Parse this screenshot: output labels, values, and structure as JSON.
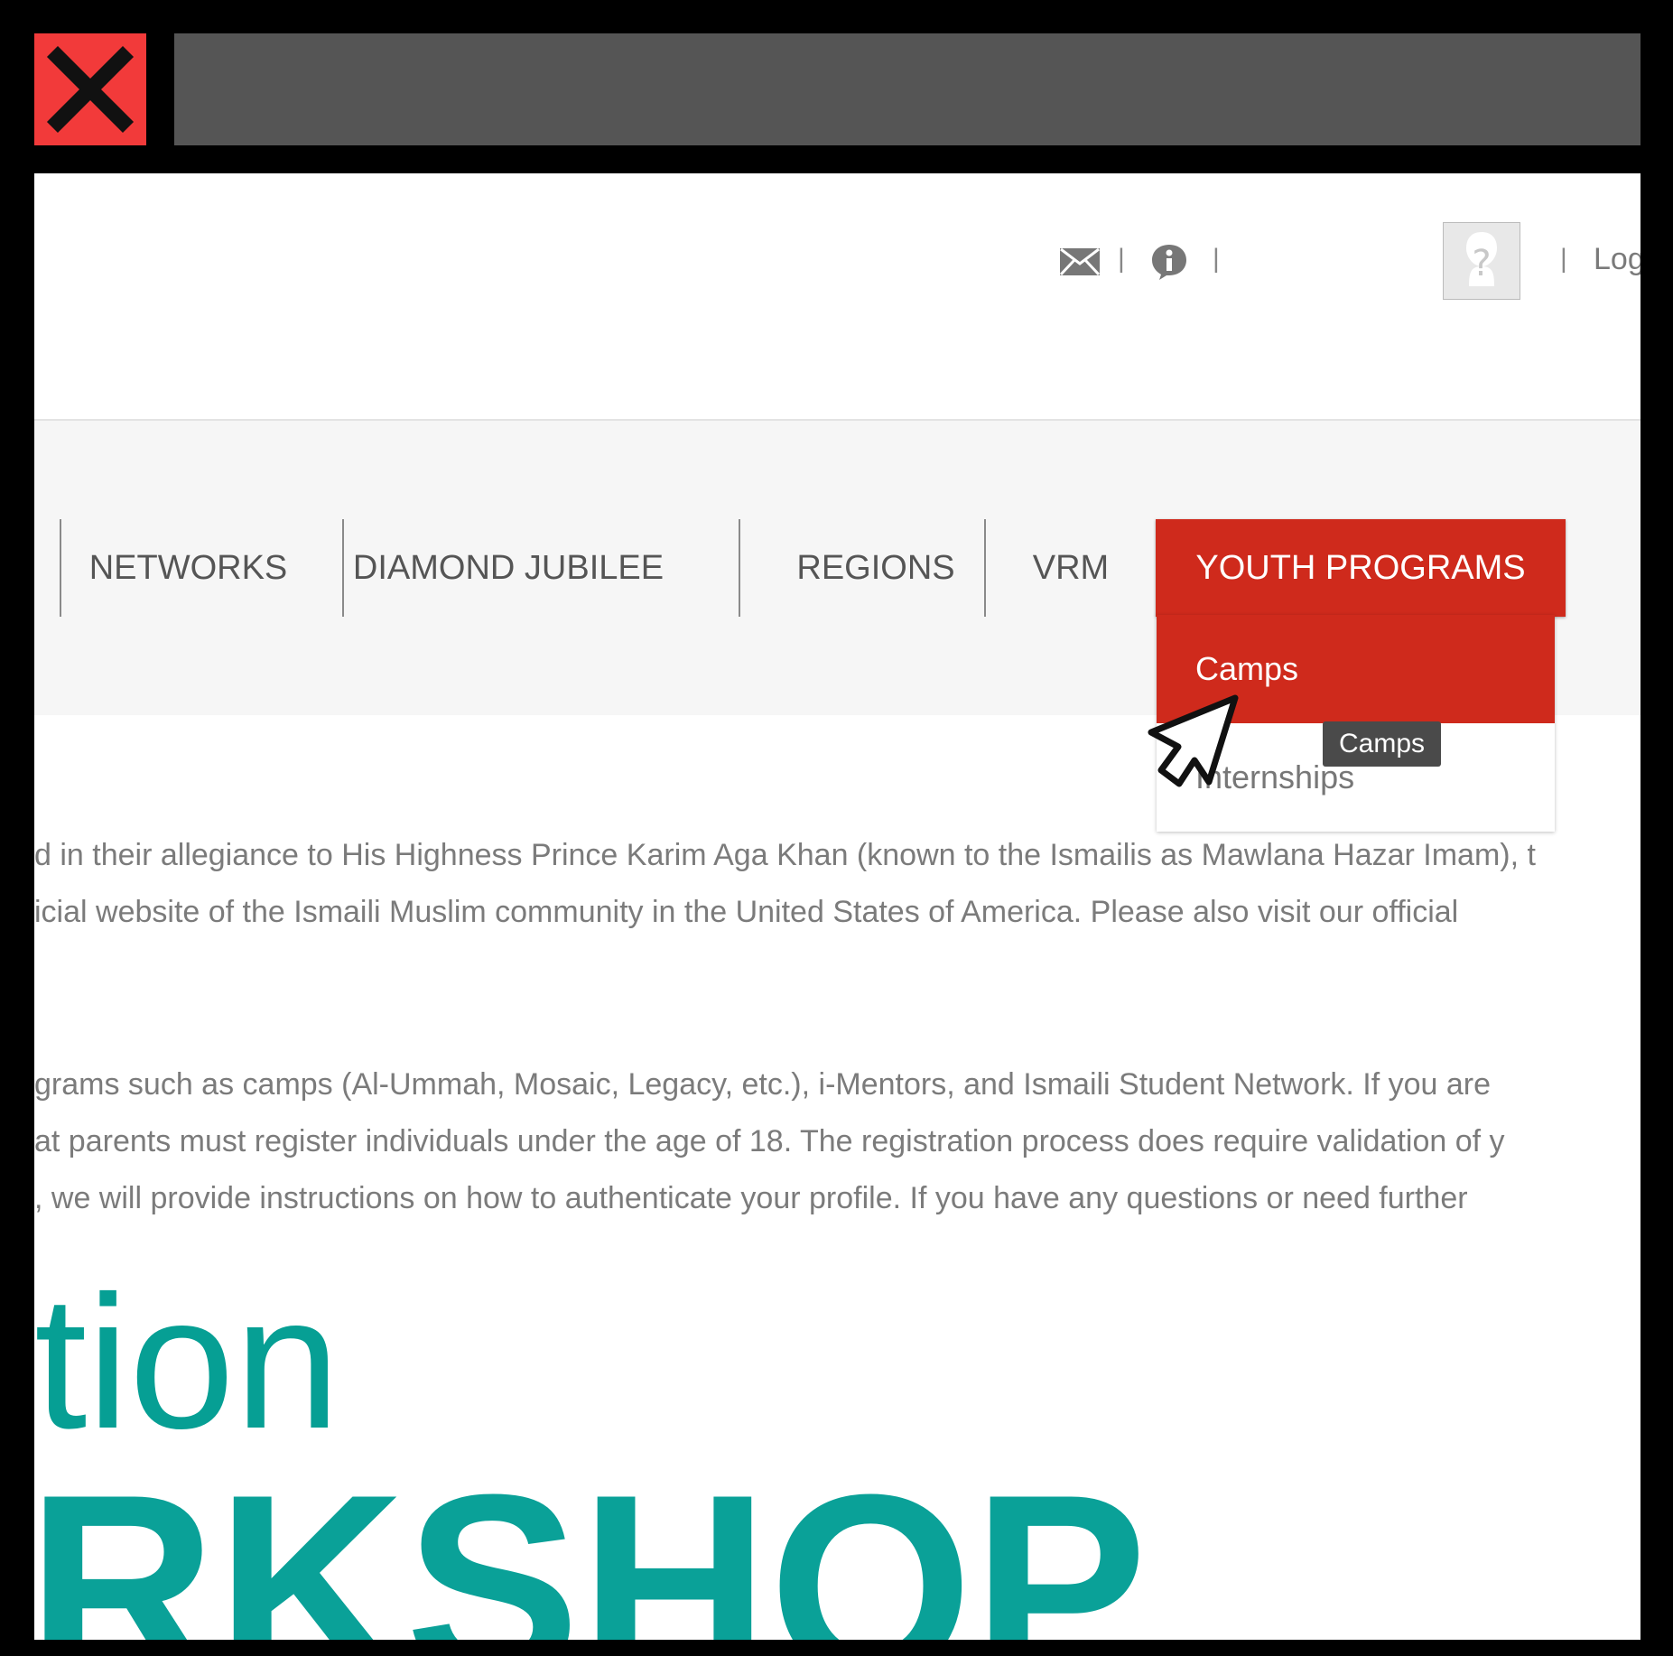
{
  "window": {
    "close_icon": "close-x-icon",
    "close_color": "#f23a3a",
    "titlebar_color": "#555555"
  },
  "utility_bar": {
    "mail_icon": "envelope-icon",
    "info_icon": "info-icon",
    "separator": "|",
    "avatar_icon": "user-placeholder-icon",
    "login_label": "Log"
  },
  "nav": {
    "items": [
      {
        "label": "NETWORKS"
      },
      {
        "label": "DIAMOND JUBILEE"
      },
      {
        "label": "REGIONS"
      },
      {
        "label": "VRM"
      },
      {
        "label": "YOUTH PROGRAMS"
      }
    ],
    "active_color": "#cf2a1c"
  },
  "dropdown": {
    "items": [
      {
        "label": "Camps"
      },
      {
        "label": "Internships"
      }
    ],
    "tooltip": "Camps"
  },
  "content": {
    "lines": [
      "d in their allegiance to His Highness Prince Karim Aga Khan (known to the Ismailis as Mawlana Hazar Imam), t",
      "icial website of the Ismaili Muslim community in the United States of America. Please also visit our official",
      "grams such as camps (Al-Ummah, Mosaic, Legacy, etc.), i-Mentors, and Ismaili Student Network. If you are",
      "at parents must register individuals under the age of 18. The registration process does require validation of y",
      ", we will provide instructions on how to authenticate your profile. If you have any questions or need further"
    ],
    "hero_line1": "tion",
    "hero_line2": "RKSHOP",
    "hero_color": "#0aa198"
  }
}
